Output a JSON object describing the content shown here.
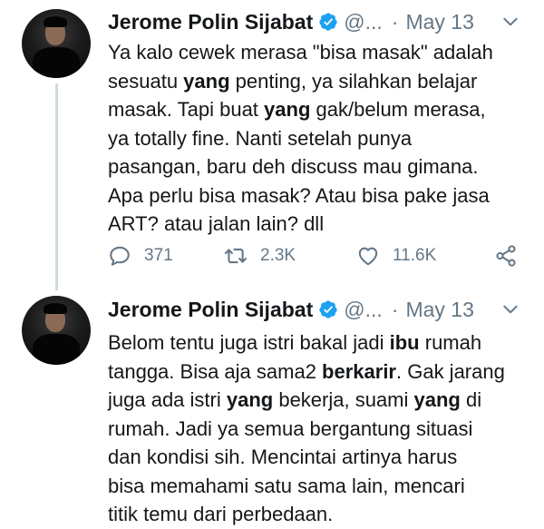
{
  "tweets": [
    {
      "name": "Jerome Polin Sijabat",
      "handle": "@...",
      "separator": "·",
      "date": "May 13",
      "verified_icon": "verified-badge-icon",
      "lines": [
        [
          {
            "t": "Ya kalo cewek merasa \"bisa masak\" adalah"
          }
        ],
        [
          {
            "t": "sesuatu "
          },
          {
            "t": "yang",
            "b": true
          },
          {
            "t": " penting, ya silahkan belajar"
          }
        ],
        [
          {
            "t": "masak. Tapi buat "
          },
          {
            "t": "yang",
            "b": true
          },
          {
            "t": " gak/belum merasa,"
          }
        ],
        [
          {
            "t": "ya totally fine. Nanti setelah punya"
          }
        ],
        [
          {
            "t": "pasangan, baru deh discuss mau gimana."
          }
        ],
        [
          {
            "t": "Apa perlu bisa masak? Atau bisa pake jasa"
          }
        ],
        [
          {
            "t": "ART? atau jalan lain? dll"
          }
        ]
      ],
      "actions": {
        "replies": "371",
        "retweets": "2.3K",
        "likes": "11.6K"
      }
    },
    {
      "name": "Jerome Polin Sijabat",
      "handle": "@...",
      "separator": "·",
      "date": "May 13",
      "verified_icon": "verified-badge-icon",
      "lines": [
        [
          {
            "t": "Belom tentu juga istri bakal jadi "
          },
          {
            "t": "ibu",
            "b": true
          },
          {
            "t": " rumah"
          }
        ],
        [
          {
            "t": "tangga. Bisa aja sama2 "
          },
          {
            "t": "berkarir",
            "b": true
          },
          {
            "t": ". Gak jarang"
          }
        ],
        [
          {
            "t": "juga ada istri "
          },
          {
            "t": "yang",
            "b": true
          },
          {
            "t": " bekerja, suami "
          },
          {
            "t": "yang",
            "b": true
          },
          {
            "t": " di"
          }
        ],
        [
          {
            "t": "rumah. Jadi ya semua bergantung situasi"
          }
        ],
        [
          {
            "t": "dan kondisi sih. Mencintai artinya harus"
          }
        ],
        [
          {
            "t": "bisa memahami satu sama lain, mencari"
          }
        ],
        [
          {
            "t": "titik temu dari perbedaan."
          }
        ]
      ]
    }
  ],
  "colors": {
    "text": "#14171a",
    "secondary": "#657786",
    "verified": "#1da1f2",
    "thread_line": "#cfd9de"
  }
}
